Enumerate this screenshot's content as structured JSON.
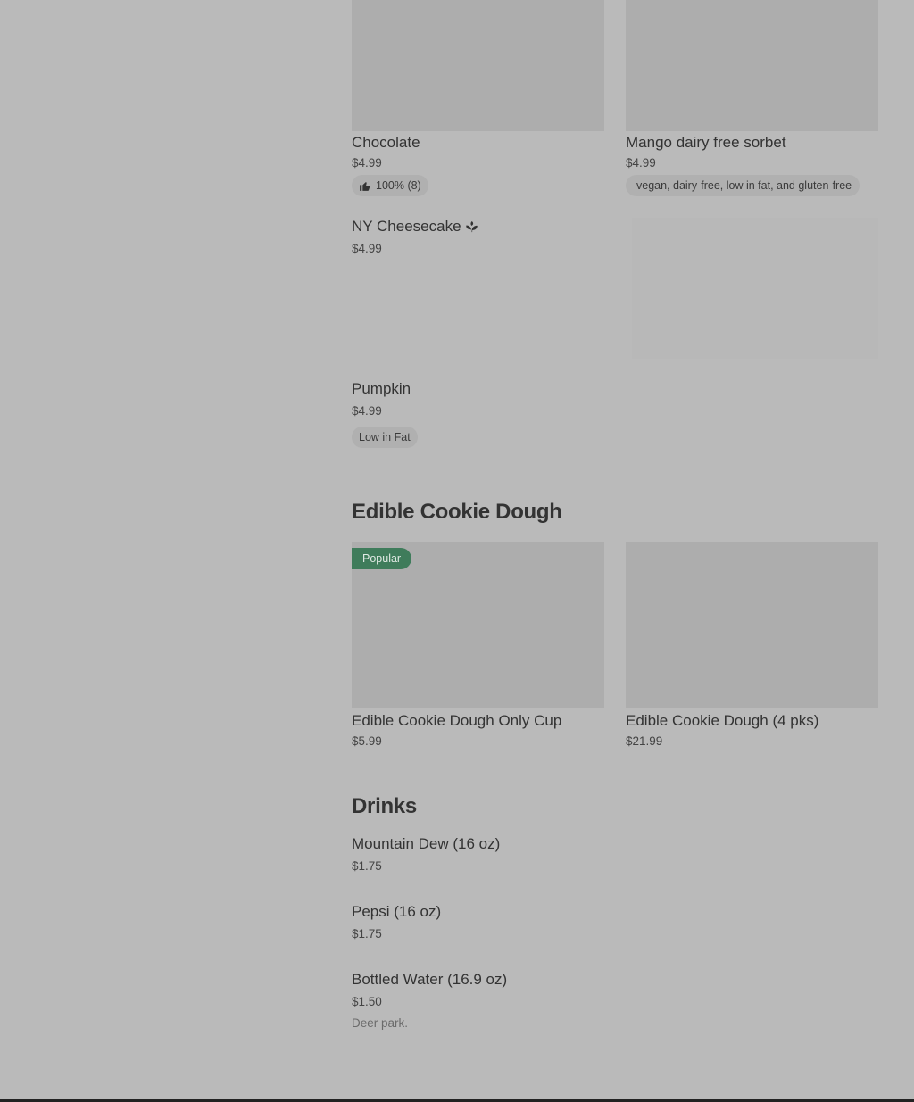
{
  "colors": {
    "background": "#bababa",
    "image_placeholder": "#adadad",
    "popular_badge": "#3f7c5b",
    "text": "#333333"
  },
  "items_top": [
    {
      "title": "Chocolate",
      "price": "$4.99",
      "rating": "100% (8)"
    },
    {
      "title": "Mango dairy free sorbet",
      "price": "$4.99",
      "tags": "vegan, dairy-free, low in fat, and gluten-free"
    }
  ],
  "cheesecake": {
    "title": "NY Cheesecake",
    "icon": "plant-icon",
    "price": "$4.99"
  },
  "pumpkin": {
    "title": "Pumpkin",
    "price": "$4.99",
    "tag": "Low in Fat"
  },
  "cookie_dough": {
    "heading": "Edible Cookie Dough",
    "items": [
      {
        "title": "Edible Cookie Dough Only Cup",
        "price": "$5.99",
        "badge": "Popular"
      },
      {
        "title": "Edible Cookie Dough (4 pks)",
        "price": "$21.99"
      }
    ]
  },
  "drinks": {
    "heading": "Drinks",
    "items": [
      {
        "title": "Mountain Dew (16 oz)",
        "price": "$1.75"
      },
      {
        "title": "Pepsi (16 oz)",
        "price": "$1.75"
      },
      {
        "title": "Bottled Water (16.9 oz)",
        "price": "$1.50",
        "description": "Deer park."
      }
    ]
  }
}
